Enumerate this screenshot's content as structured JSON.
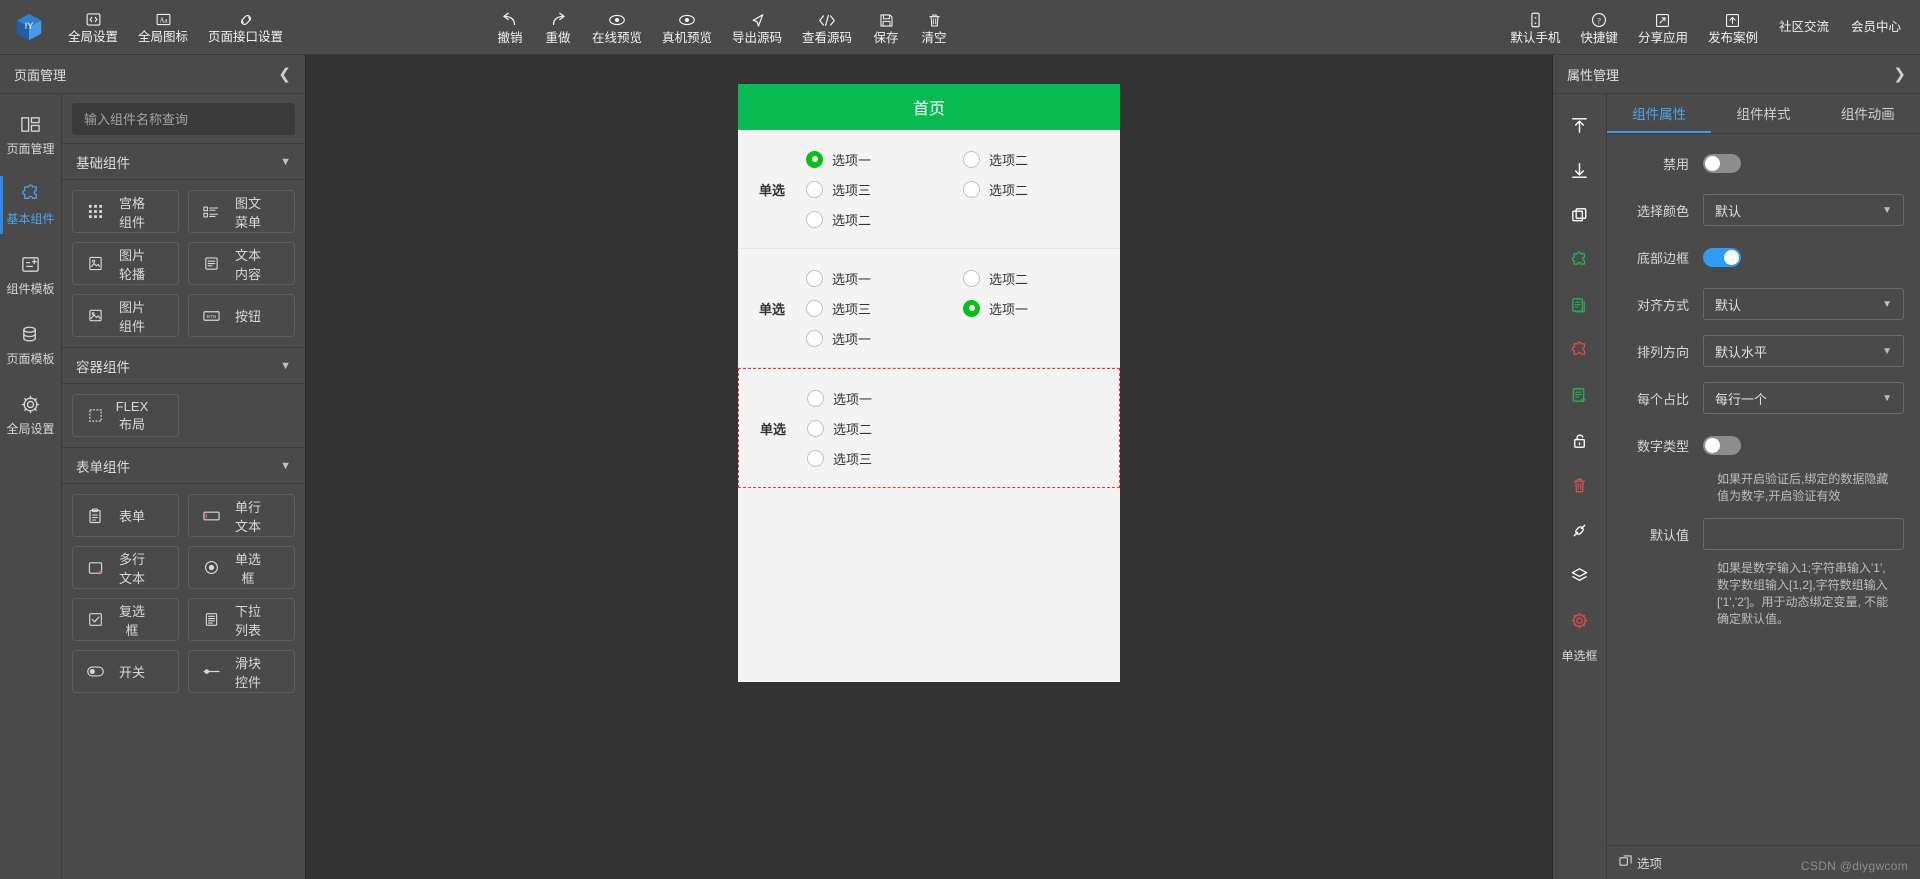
{
  "topbar": {
    "logo_name": "logo-cube",
    "left_items": [
      {
        "label": "全局设置",
        "icon": "code-folder-icon"
      },
      {
        "label": "全局图标",
        "icon": "font-aa-icon"
      },
      {
        "label": "页面接口设置",
        "icon": "link-icon"
      }
    ],
    "center_items": [
      {
        "label": "撤销",
        "icon": "undo-arrow-icon"
      },
      {
        "label": "重做",
        "icon": "redo-arrow-icon"
      },
      {
        "label": "在线预览",
        "icon": "eye-icon"
      },
      {
        "label": "真机预览",
        "icon": "eye-icon"
      },
      {
        "label": "导出源码",
        "icon": "send-icon"
      },
      {
        "label": "查看源码",
        "icon": "code-brackets-icon"
      },
      {
        "label": "保存",
        "icon": "save-disk-icon"
      },
      {
        "label": "清空",
        "icon": "trash-icon"
      }
    ],
    "right_items": [
      {
        "label": "默认手机",
        "icon": "phone-icon"
      },
      {
        "label": "快捷键",
        "icon": "question-circle-icon"
      },
      {
        "label": "分享应用",
        "icon": "share-icon"
      },
      {
        "label": "发布案例",
        "icon": "publish-icon"
      }
    ],
    "right_links": [
      "社区交流",
      "会员中心"
    ]
  },
  "left_panel": {
    "title": "页面管理",
    "collapse_icon": "chevron-left-icon",
    "rail": [
      {
        "label": "页面管理",
        "icon": "layout-columns-icon",
        "active": false
      },
      {
        "label": "基本组件",
        "icon": "puzzle-icon",
        "active": true
      },
      {
        "label": "组件模板",
        "icon": "template-add-icon",
        "active": false
      },
      {
        "label": "页面模板",
        "icon": "database-icon",
        "active": false
      },
      {
        "label": "全局设置",
        "icon": "gear-icon",
        "active": false
      }
    ],
    "search_placeholder": "输入组件名称查询",
    "sections": [
      {
        "title": "基础组件",
        "components": [
          {
            "label": "宫格组件",
            "icon": "grid-icon"
          },
          {
            "label": "图文菜单",
            "icon": "list-icon"
          },
          {
            "label": "图片轮播",
            "icon": "carousel-icon"
          },
          {
            "label": "文本内容",
            "icon": "text-lines-icon"
          },
          {
            "label": "图片组件",
            "icon": "image-icon"
          },
          {
            "label": "按钮",
            "icon": "btn-icon"
          }
        ]
      },
      {
        "title": "容器组件",
        "components": [
          {
            "label": "FLEX布局",
            "icon": "dashed-box-icon"
          }
        ]
      },
      {
        "title": "表单组件",
        "components": [
          {
            "label": "表单",
            "icon": "clipboard-icon"
          },
          {
            "label": "单行文本",
            "icon": "input-box-icon"
          },
          {
            "label": "多行文本",
            "icon": "textarea-icon"
          },
          {
            "label": "单选框",
            "icon": "radio-icon"
          },
          {
            "label": "复选框",
            "icon": "checkbox-icon"
          },
          {
            "label": "下拉列表",
            "icon": "dropdown-icon"
          },
          {
            "label": "开关",
            "icon": "toggle-icon"
          },
          {
            "label": "滑块控件",
            "icon": "slider-icon"
          }
        ]
      }
    ]
  },
  "canvas": {
    "page_title": "首页",
    "radio_groups": [
      {
        "label": "单选",
        "columns": 2,
        "selected": false,
        "options": [
          {
            "text": "选项一",
            "checked": true
          },
          {
            "text": "选项二",
            "checked": false
          },
          {
            "text": "选项三",
            "checked": false
          },
          {
            "text": "选项二",
            "checked": false
          },
          {
            "text": "选项二",
            "checked": false
          }
        ]
      },
      {
        "label": "单选",
        "columns": 2,
        "selected": false,
        "options": [
          {
            "text": "选项一",
            "checked": false
          },
          {
            "text": "选项二",
            "checked": false
          },
          {
            "text": "选项三",
            "checked": false
          },
          {
            "text": "选项一",
            "checked": true
          },
          {
            "text": "选项一",
            "checked": false
          }
        ]
      },
      {
        "label": "单选",
        "columns": 1,
        "selected": true,
        "options": [
          {
            "text": "选项一",
            "checked": false
          },
          {
            "text": "选项二",
            "checked": false
          },
          {
            "text": "选项三",
            "checked": false
          }
        ]
      }
    ]
  },
  "right_panel": {
    "title": "属性管理",
    "expand_icon": "chevron-right-icon",
    "tools": [
      {
        "icon": "move-to-top-icon",
        "color": "#ffffff"
      },
      {
        "icon": "move-to-bottom-icon",
        "color": "#ffffff"
      },
      {
        "icon": "copy-icon",
        "color": "#ffffff"
      },
      {
        "icon": "puzzle-green-icon",
        "color": "#26b050"
      },
      {
        "icon": "documents-green-icon",
        "color": "#26b050"
      },
      {
        "icon": "puzzle-red-icon",
        "color": "#e04b4b"
      },
      {
        "icon": "doc-add-green-icon",
        "color": "#26b050"
      },
      {
        "icon": "unlock-icon",
        "color": "#ffffff"
      },
      {
        "icon": "trash-red-icon",
        "color": "#e04b4b"
      },
      {
        "icon": "plug-icon",
        "color": "#ffffff"
      },
      {
        "icon": "layers-icon",
        "color": "#ffffff"
      },
      {
        "icon": "gear-red-icon",
        "color": "#e04b4b"
      }
    ],
    "tool_caption": "单选框",
    "tabs": [
      {
        "label": "组件属性",
        "active": true
      },
      {
        "label": "组件样式",
        "active": false
      },
      {
        "label": "组件动画",
        "active": false
      }
    ],
    "properties": [
      {
        "label": "禁用",
        "type": "switch",
        "on": false
      },
      {
        "label": "选择颜色",
        "type": "select",
        "value": "默认"
      },
      {
        "label": "底部边框",
        "type": "switch",
        "on": true
      },
      {
        "label": "对齐方式",
        "type": "select",
        "value": "默认"
      },
      {
        "label": "排列方向",
        "type": "select",
        "value": "默认水平"
      },
      {
        "label": "每个占比",
        "type": "select",
        "value": "每行一个"
      },
      {
        "label": "数字类型",
        "type": "switch",
        "on": false,
        "hint": "如果开启验证后,绑定的数据隐藏值为数字,开启验证有效"
      },
      {
        "label": "默认值",
        "type": "text",
        "value": "",
        "hint": "如果是数字输入1;字符串输入'1', 数字数组输入[1,2],字符数组输入['1','2']。用于动态绑定变量, 不能确定默认值。"
      }
    ],
    "footer_label": "选项",
    "footer_icon": "options-icon"
  },
  "watermark": "CSDN @diygwcom"
}
